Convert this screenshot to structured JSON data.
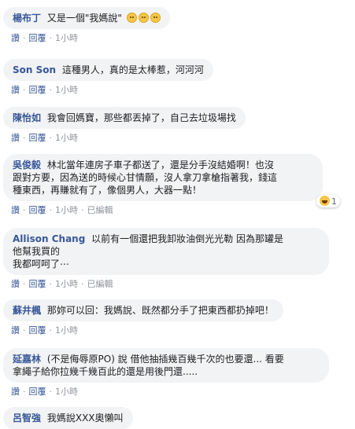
{
  "comments": [
    {
      "author": "楊布丁",
      "text": "又是一個\"我媽說\"",
      "emoji": [
        "worried-face-icon",
        "worried-face-icon",
        "worried-face-icon"
      ],
      "like": "讚",
      "reply": "回覆",
      "time": "1小時"
    },
    {
      "author": "Son Son",
      "text": "這種男人，真的是太棒惹，河河河",
      "like": "讚",
      "reply": "回覆",
      "time": "1小時"
    },
    {
      "author": "陳怡如",
      "text": "我會回媽寶，那些都丟掉了，自己去垃圾場找",
      "like": "讚",
      "reply": "回覆",
      "time": "1小時"
    },
    {
      "author": "吳俊毅",
      "text_lines": [
        "林北當年連房子車子都送了，還是分手沒結婚啊！也沒",
        "跟對方要，因為送的時候心甘情願，沒人拿刀拿槍指著我，錢這",
        "種東西，再賺就有了，像個男人，大器一點！"
      ],
      "like": "讚",
      "reply": "回覆",
      "time": "1小時",
      "edited": "已編輯",
      "reaction_count": "1"
    },
    {
      "author": "Allison Chang",
      "text_lines": [
        "以前有一個還把我卸妝油倒光光勒 因為那罐是",
        "他幫我買的",
        "我都呵呵了⋯"
      ],
      "like": "讚",
      "reply": "回覆",
      "time": "1小時",
      "edited": "已編輯"
    },
    {
      "author": "蘇井楓",
      "text": "那妳可以回：我媽說、既然都分手了把東西都扔掉吧！",
      "like": "讚",
      "reply": "回覆",
      "time": "1小時"
    },
    {
      "author": "延嘉林",
      "text_lines": [
        "(不是侮辱原PO) 說 借他抽插幾百幾千次的也要還... 看要",
        "拿繩子給你拉幾千幾百此的還是用後門還....."
      ],
      "like": "讚",
      "reply": "回覆",
      "time": "1小時"
    },
    {
      "author": "呂智強",
      "text": "我媽說XXX奧懶叫"
    }
  ],
  "colors": {
    "bubble": "#f2f3f5",
    "author": "#385898",
    "meta": "#90949c"
  }
}
